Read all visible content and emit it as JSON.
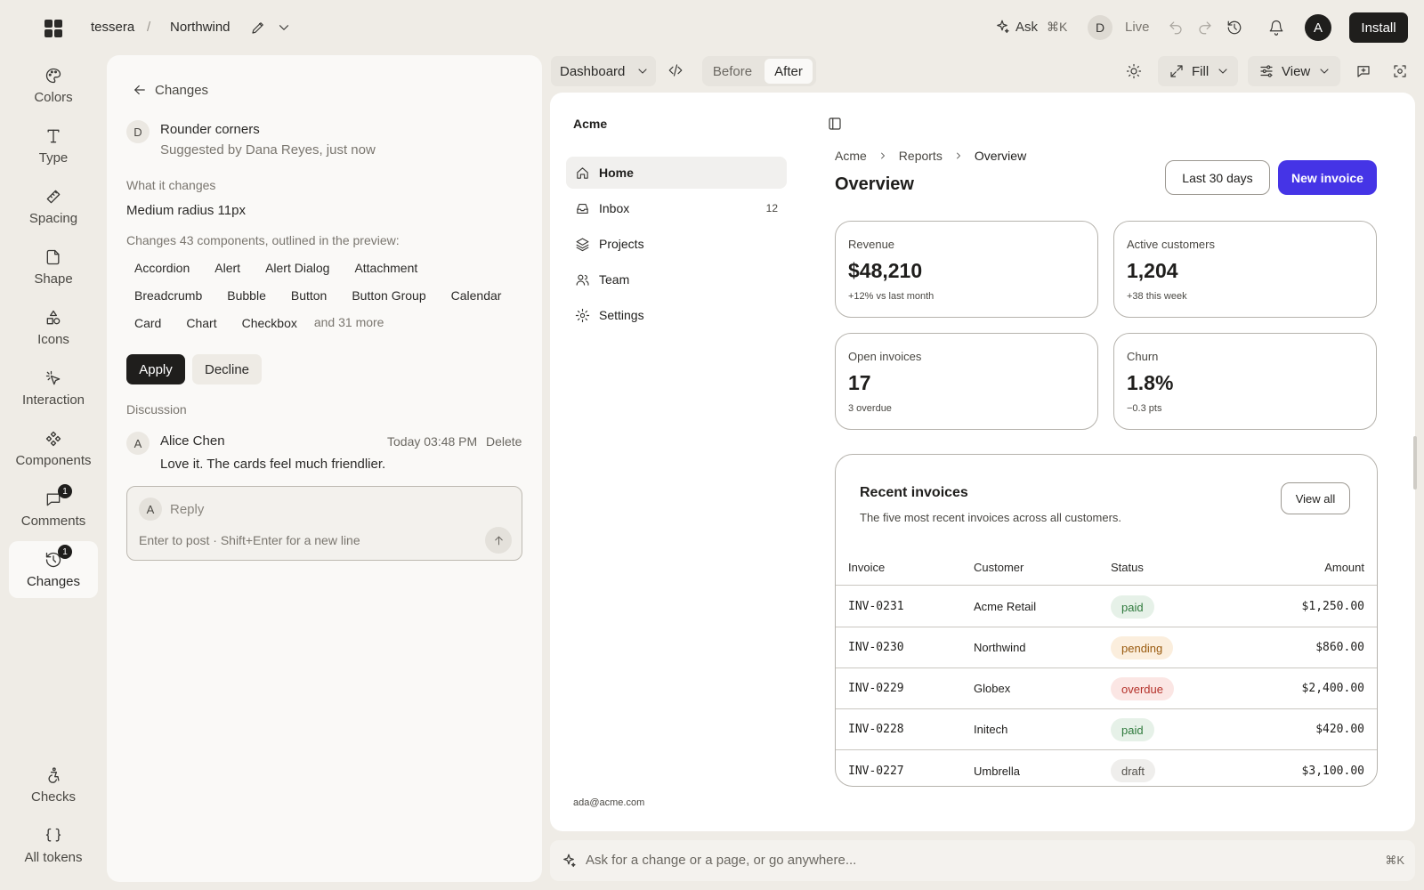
{
  "topbar": {
    "org": "tessera",
    "separator": "/",
    "project": "Northwind",
    "ask_label": "Ask",
    "ask_shortcut": "⌘K",
    "live_avatar": "D",
    "live_label": "Live",
    "user_avatar": "A",
    "install_label": "Install"
  },
  "rail": {
    "items": [
      {
        "label": "Colors",
        "icon": "palette-icon"
      },
      {
        "label": "Type",
        "icon": "type-icon"
      },
      {
        "label": "Spacing",
        "icon": "ruler-icon"
      },
      {
        "label": "Shape",
        "icon": "shape-icon"
      },
      {
        "label": "Icons",
        "icon": "shapes-icon"
      },
      {
        "label": "Interaction",
        "icon": "pointer-icon"
      },
      {
        "label": "Components",
        "icon": "components-icon"
      },
      {
        "label": "Comments",
        "icon": "comment-icon",
        "badge": "1"
      },
      {
        "label": "Changes",
        "icon": "history-icon",
        "badge": "1",
        "active": true
      }
    ],
    "bottom": [
      {
        "label": "Checks",
        "icon": "accessibility-icon"
      },
      {
        "label": "All tokens",
        "icon": "braces-icon"
      }
    ]
  },
  "changes": {
    "back_label": "Changes",
    "suggestion": {
      "avatar": "D",
      "title": "Rounder corners",
      "subtitle": "Suggested by Dana Reyes, just now"
    },
    "what_label": "What it changes",
    "what_value": "Medium radius 11px",
    "components_label": "Changes 43 components, outlined in the preview:",
    "components": [
      "Accordion",
      "Alert",
      "Alert Dialog",
      "Attachment",
      "Breadcrumb",
      "Bubble",
      "Button",
      "Button Group",
      "Calendar",
      "Card",
      "Chart",
      "Checkbox"
    ],
    "more_label": "and 31 more",
    "apply_label": "Apply",
    "decline_label": "Decline",
    "discussion_label": "Discussion",
    "comment": {
      "avatar": "A",
      "author": "Alice Chen",
      "time": "Today 03:48 PM",
      "delete_label": "Delete",
      "text": "Love it. The cards feel much friendlier."
    },
    "reply": {
      "avatar": "A",
      "placeholder": "Reply",
      "hint": "Enter to post · Shift+Enter for a new line"
    }
  },
  "preview_toolbar": {
    "page_select": "Dashboard",
    "before_label": "Before",
    "after_label": "After",
    "fill_label": "Fill",
    "view_label": "View"
  },
  "preview": {
    "brand": "Acme",
    "nav": [
      {
        "label": "Home",
        "icon": "home-icon",
        "active": true
      },
      {
        "label": "Inbox",
        "icon": "inbox-icon",
        "count": "12"
      },
      {
        "label": "Projects",
        "icon": "layers-icon"
      },
      {
        "label": "Team",
        "icon": "users-icon"
      },
      {
        "label": "Settings",
        "icon": "gear-icon"
      }
    ],
    "user_email": "ada@acme.com",
    "breadcrumb": [
      "Acme",
      "Reports",
      "Overview"
    ],
    "title": "Overview",
    "range_label": "Last 30 days",
    "new_invoice_label": "New invoice",
    "stats": [
      {
        "label": "Revenue",
        "value": "$48,210",
        "sub": "+12% vs last month"
      },
      {
        "label": "Active customers",
        "value": "1,204",
        "sub": "+38 this week"
      },
      {
        "label": "Open invoices",
        "value": "17",
        "sub": "3 overdue"
      },
      {
        "label": "Churn",
        "value": "1.8%",
        "sub": "−0.3 pts"
      }
    ],
    "invoices": {
      "title": "Recent invoices",
      "description": "The five most recent invoices across all customers.",
      "view_all_label": "View all",
      "columns": [
        "Invoice",
        "Customer",
        "Status",
        "Amount"
      ],
      "rows": [
        {
          "invoice": "INV-0231",
          "customer": "Acme Retail",
          "status": "paid",
          "amount": "$1,250.00"
        },
        {
          "invoice": "INV-0230",
          "customer": "Northwind",
          "status": "pending",
          "amount": "$860.00"
        },
        {
          "invoice": "INV-0229",
          "customer": "Globex",
          "status": "overdue",
          "amount": "$2,400.00"
        },
        {
          "invoice": "INV-0228",
          "customer": "Initech",
          "status": "paid",
          "amount": "$420.00"
        },
        {
          "invoice": "INV-0227",
          "customer": "Umbrella",
          "status": "draft",
          "amount": "$3,100.00"
        }
      ]
    }
  },
  "prompt": {
    "placeholder": "Ask for a change or a page, or go anywhere...",
    "shortcut": "⌘K"
  },
  "colors": {
    "accent": "#4534e6",
    "paid": "#2f7a3d",
    "pending": "#9a5b0f",
    "overdue": "#b4312a",
    "draft": "#55524d"
  }
}
